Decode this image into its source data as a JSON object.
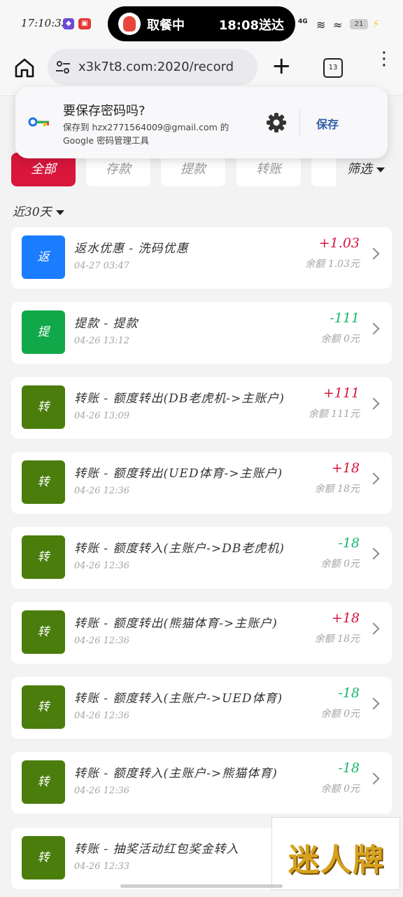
{
  "status_bar": {
    "time": "17:10:35",
    "island_left": "取餐中",
    "island_right": "18:08送达",
    "network": "4G",
    "battery": "21"
  },
  "browser": {
    "url": "x3k7t8.com:2020/record",
    "tab_count": "13"
  },
  "password_prompt": {
    "title": "要保存密码吗?",
    "description": "保存到 hzx2771564009@gmail.com 的 Google 密码管理工具",
    "save_label": "保存"
  },
  "filters": {
    "tabs": [
      {
        "label": "全部",
        "active": true
      },
      {
        "label": "存款",
        "active": false
      },
      {
        "label": "提款",
        "active": false
      },
      {
        "label": "转账",
        "active": false
      }
    ],
    "filter_label": "筛选",
    "range_label": "近30天"
  },
  "records": [
    {
      "badge": "返",
      "badge_color": "#1a7cff",
      "title": "返水优惠 - 洗码优惠",
      "date": "04-27 03:47",
      "amount": "+1.03",
      "amount_color": "#d9163c",
      "balance": "余额 1.03元"
    },
    {
      "badge": "提",
      "badge_color": "#11a84a",
      "title": "提款 - 提款",
      "date": "04-26 13:12",
      "amount": "-111",
      "amount_color": "#17b86b",
      "balance": "余额 0元"
    },
    {
      "badge": "转",
      "badge_color": "#4a7d0c",
      "title": "转账 - 额度转出(DB老虎机->主账户)",
      "date": "04-26 13:09",
      "amount": "+111",
      "amount_color": "#d9163c",
      "balance": "余额 111元"
    },
    {
      "badge": "转",
      "badge_color": "#4a7d0c",
      "title": "转账 - 额度转出(UED体育->主账户)",
      "date": "04-26 12:36",
      "amount": "+18",
      "amount_color": "#d9163c",
      "balance": "余额 18元"
    },
    {
      "badge": "转",
      "badge_color": "#4a7d0c",
      "title": "转账 - 额度转入(主账户->DB老虎机)",
      "date": "04-26 12:36",
      "amount": "-18",
      "amount_color": "#17b86b",
      "balance": "余额 0元"
    },
    {
      "badge": "转",
      "badge_color": "#4a7d0c",
      "title": "转账 - 额度转出(熊猫体育->主账户)",
      "date": "04-26 12:36",
      "amount": "+18",
      "amount_color": "#d9163c",
      "balance": "余额 18元"
    },
    {
      "badge": "转",
      "badge_color": "#4a7d0c",
      "title": "转账 - 额度转入(主账户->UED体育)",
      "date": "04-26 12:36",
      "amount": "-18",
      "amount_color": "#17b86b",
      "balance": "余额 0元"
    },
    {
      "badge": "转",
      "badge_color": "#4a7d0c",
      "title": "转账 - 额度转入(主账户->熊猫体育)",
      "date": "04-26 12:36",
      "amount": "-18",
      "amount_color": "#17b86b",
      "balance": "余额 0元"
    },
    {
      "badge": "转",
      "badge_color": "#4a7d0c",
      "title": "转账 - 抽奖活动红包奖金转入",
      "date": "04-26 12:33",
      "amount": "",
      "amount_color": "#d9163c",
      "balance": ""
    }
  ],
  "watermark": "迷人牌"
}
